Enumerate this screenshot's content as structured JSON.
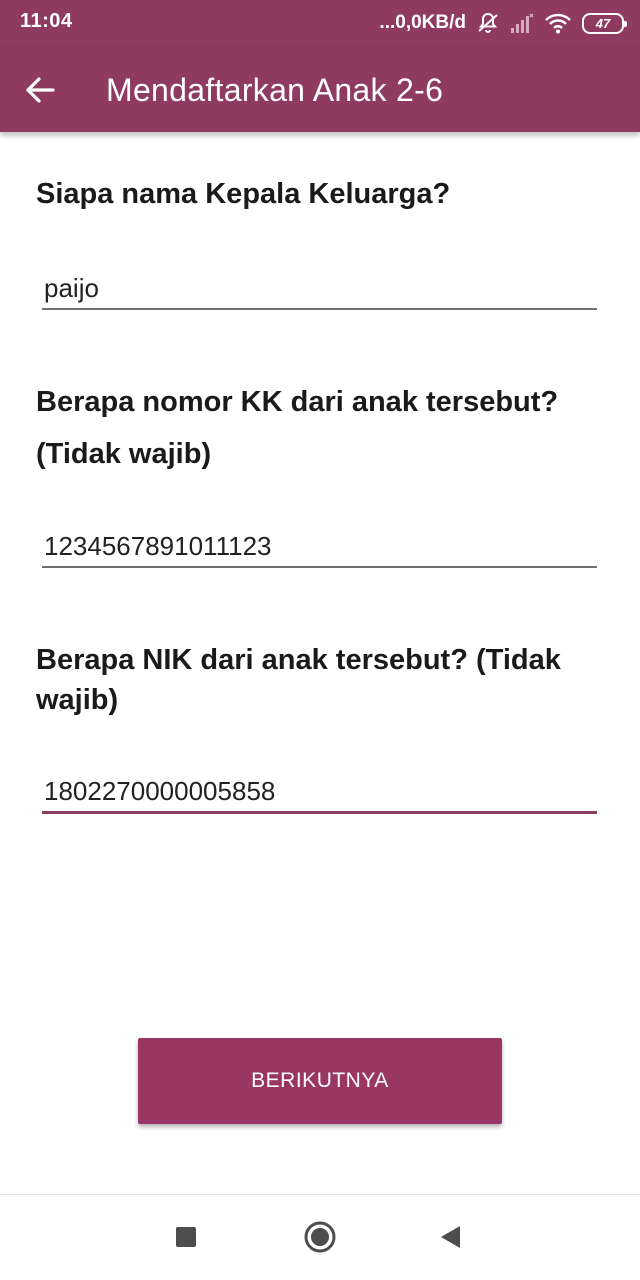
{
  "status_bar": {
    "time": "11:04",
    "network_speed": "...0,0KB/d",
    "battery_level": "47",
    "icons": [
      "notifications-off-icon",
      "signal-icon",
      "wifi-icon",
      "battery-icon"
    ]
  },
  "app_bar": {
    "title": "Mendaftarkan Anak 2-6",
    "back_icon": "arrow-left-icon",
    "color": "#8f3a61"
  },
  "form": {
    "head_of_family": {
      "question": "Siapa nama Kepala Keluarga?",
      "value": "paijo"
    },
    "kk_number": {
      "question": "Berapa nomor KK dari anak tersebut? (Tidak wajib)",
      "value": "1234567891011123"
    },
    "nik_number": {
      "question": "Berapa NIK dari anak tersebut? (Tidak wajib)",
      "value": "1802270000005858"
    }
  },
  "actions": {
    "next_label": "BERIKUTNYA",
    "accent_color": "#9a3663"
  },
  "nav_bar": {
    "icons": [
      "recent-apps-icon",
      "home-icon",
      "back-triangle-icon"
    ]
  }
}
